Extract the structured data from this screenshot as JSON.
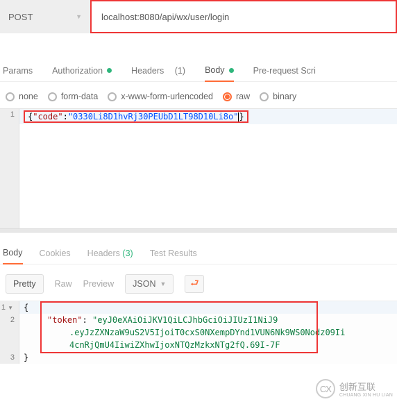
{
  "request": {
    "method": "POST",
    "url": "localhost:8080/api/wx/user/login"
  },
  "req_tabs": {
    "params": "Params",
    "auth": "Authorization",
    "headers": "Headers",
    "headers_count": "(1)",
    "body": "Body",
    "prereq": "Pre-request Scri"
  },
  "body_types": {
    "none": "none",
    "form": "form-data",
    "xform": "x-www-form-urlencoded",
    "raw": "raw",
    "binary": "binary"
  },
  "req_body": {
    "line1_gutter": "1",
    "open": "{",
    "keyq": "\"code\"",
    "colon": ":",
    "valq": "\"0330Li8D1hvRj30PEUbD1LT98D10Li8o\"",
    "close": "}"
  },
  "resp_tabs": {
    "body": "Body",
    "cookies": "Cookies",
    "headers": "Headers",
    "headers_count": "(3)",
    "tests": "Test Results"
  },
  "resp_toolbar": {
    "pretty": "Pretty",
    "raw": "Raw",
    "preview": "Preview",
    "format": "JSON"
  },
  "resp_body": {
    "g1": "1",
    "g2": "2",
    "g3": "3",
    "open": "{",
    "keyq": "\"token\"",
    "colon": ": ",
    "val1": "\"eyJ0eXAiOiJKV1QiLCJhbGciOiJIUzI1NiJ9",
    "val2": ".eyJzZXNzaW9uS2V5IjoiT0cxS0NXempDYnd1VUN6Nk9WS0Nodz09Ii",
    "val3": "4cnRjQmU4IiwiZXhwIjoxNTQzMzkxNTg2fQ.69I-7F",
    "close": "}"
  },
  "watermark": {
    "brand": "创新互联",
    "sub": "CHUANG XIN HU LIAN"
  }
}
